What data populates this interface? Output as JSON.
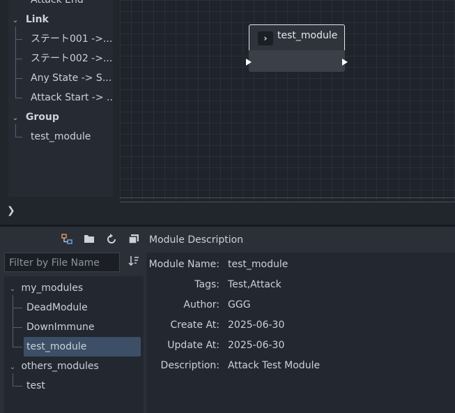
{
  "outline": {
    "cut_item": "Attack End",
    "link_label": "Link",
    "links": [
      "ステート001 ->...",
      "ステート002 ->...",
      "Any State -> S...",
      "Attack Start -> ..."
    ],
    "group_label": "Group",
    "groups": [
      "test_module"
    ]
  },
  "graph": {
    "node_title": "test_module",
    "node_icon": "chevron-right-icon"
  },
  "bottom_toggle": "❯",
  "toolbar": {
    "icons": [
      "hierarchy-icon",
      "folder-icon",
      "reload-icon",
      "copy-icon"
    ]
  },
  "description_title": "Module Description",
  "filter": {
    "placeholder": "Filter by File Name"
  },
  "file_tree": {
    "folders": [
      {
        "name": "my_modules",
        "items": [
          "DeadModule",
          "DownImmune",
          "test_module"
        ]
      },
      {
        "name": "others_modules",
        "items": [
          "test"
        ]
      }
    ],
    "selected": "test_module"
  },
  "module": {
    "name_label": "Module Name:",
    "name": "test_module",
    "tags_label": "Tags:",
    "tags": "Test,Attack",
    "author_label": "Author:",
    "author": "GGG",
    "create_label": "Create At:",
    "create": "2025-06-30",
    "update_label": "Update At:",
    "update": "2025-06-30",
    "desc_label": "Description:",
    "desc": "Attack Test Module"
  }
}
